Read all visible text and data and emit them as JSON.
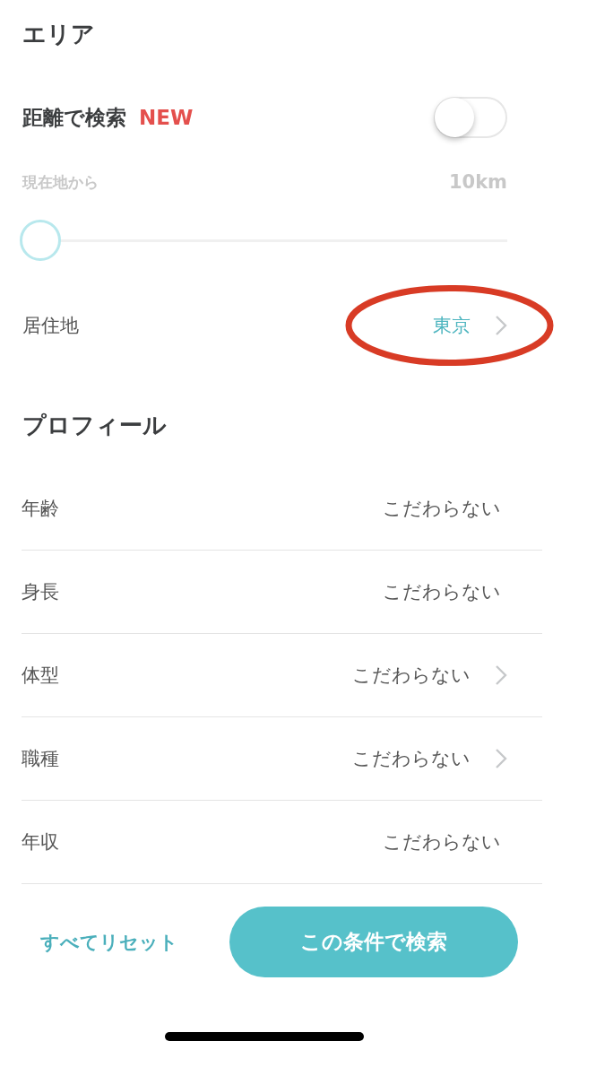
{
  "area": {
    "title": "エリア",
    "distance_search": {
      "label": "距離で検索",
      "badge": "NEW",
      "on": false,
      "origin_label": "現在地から",
      "distance": "10km",
      "level": 0
    },
    "residence": {
      "label": "居住地",
      "value": "東京",
      "chevron": true,
      "highlighted": true
    }
  },
  "profile": {
    "title": "プロフィール",
    "rows": [
      {
        "label": "年齢",
        "value": "こだわらない",
        "chevron": false
      },
      {
        "label": "身長",
        "value": "こだわらない",
        "chevron": false
      },
      {
        "label": "体型",
        "value": "こだわらない",
        "chevron": true
      },
      {
        "label": "職種",
        "value": "こだわらない",
        "chevron": true
      },
      {
        "label": "年収",
        "value": "こだわらない",
        "chevron": false
      }
    ]
  },
  "footer": {
    "reset": "すべてリセット",
    "search": "この条件で検索"
  }
}
